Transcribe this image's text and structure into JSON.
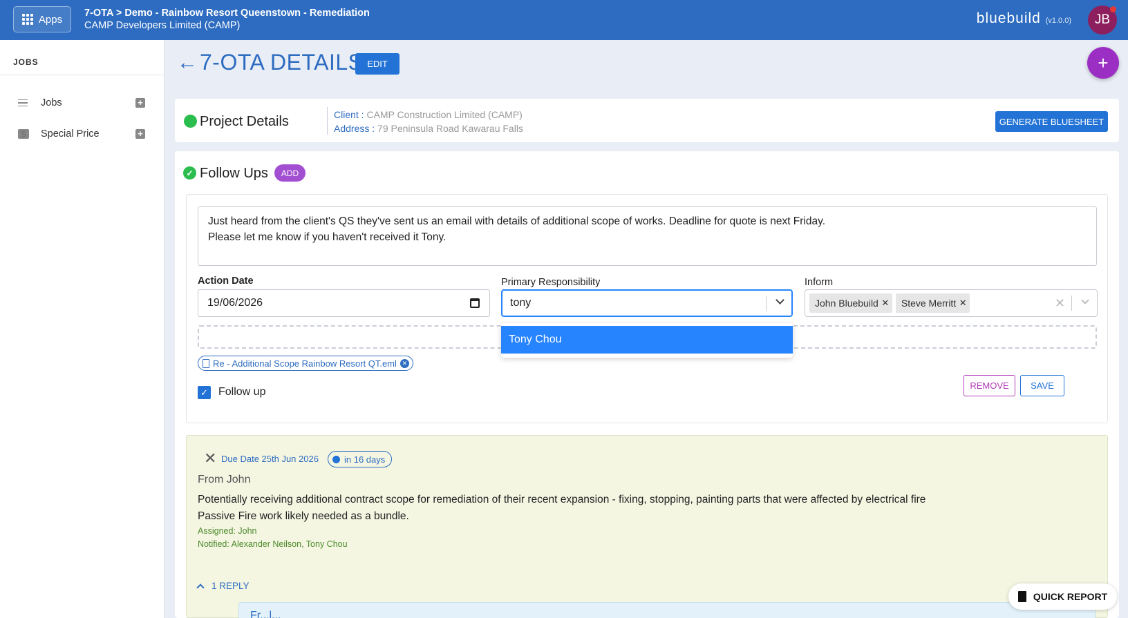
{
  "header": {
    "apps_label": "Apps",
    "breadcrumb": "7-OTA > Demo - Rainbow Resort Queenstown - Remediation",
    "org": "CAMP Developers Limited (CAMP)",
    "brand": "bluebuild",
    "version": "(v1.0.0)",
    "avatar_initials": "JB"
  },
  "sidebar": {
    "title": "JOBS",
    "items": [
      {
        "label": "Jobs",
        "icon": "list-icon"
      },
      {
        "label": "Special Price",
        "icon": "price-tag-icon"
      }
    ]
  },
  "page": {
    "title": "7-OTA DETAILS",
    "edit_label": "EDIT",
    "fab_label": "+"
  },
  "project": {
    "title": "Project Details",
    "client_key": "Client :",
    "client_value": "CAMP Construction Limited (CAMP)",
    "address_key": "Address :",
    "address_value": "79 Peninsula Road Kawarau Falls",
    "bluesheet_label": "GENERATE BLUESHEET"
  },
  "followups": {
    "title": "Follow Ups",
    "add_label": "ADD",
    "form": {
      "note": "Just heard from the client's QS they've sent us an email with details of additional scope of works. Deadline for quote is next Friday.\nPlease let me know if you haven't received it Tony.",
      "action_date_label": "Action Date",
      "action_date_value": "19/06/2026",
      "primary_label": "Primary Responsibility",
      "primary_value": "tony",
      "inform_label": "Inform",
      "inform_chips": [
        "John Bluebuild",
        "Steve Merritt"
      ],
      "attachment": "Re - Additional Scope Rainbow Resort QT.eml",
      "followup_label": "Follow up",
      "followup_checked": true,
      "remove_label": "REMOVE",
      "save_label": "SAVE",
      "dropdown_option": "Tony Chou"
    },
    "entry": {
      "due": "Due Date 25th Jun 2026",
      "badge": "in 16 days",
      "from": "From John",
      "body": "Potentially receiving additional contract scope for remediation of their recent expansion - fixing, stopping, painting parts that were affected by electrical fire\nPassive Fire work likely needed as a bundle.",
      "assigned": "Assigned: John",
      "notified": "Notified: Alexander Neilson, Tony Chou",
      "reply_label": "1 REPLY",
      "reply_preview_name": "Fr...l..."
    }
  },
  "quick_report_label": "QUICK REPORT",
  "colors": {
    "topbar": "#2d6cc0",
    "accent": "#2373d6",
    "purple": "#9b2fc3",
    "green": "#2bbd4e"
  }
}
